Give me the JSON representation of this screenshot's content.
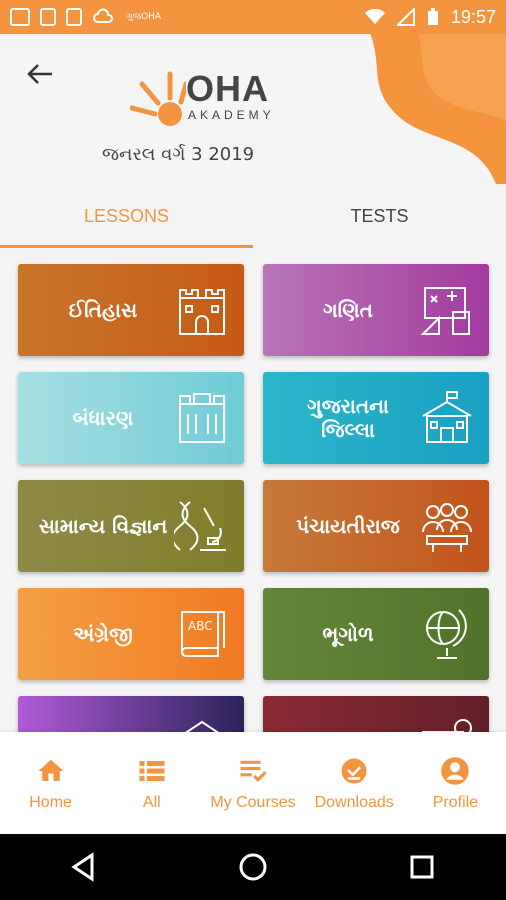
{
  "status_bar": {
    "time": "19:57",
    "small_text": "ગુજOHA"
  },
  "header": {
    "logo": {
      "main": "OHA",
      "sub": "AKADEMY"
    },
    "subtitle": "જનરલ વર્ગ 3 2019"
  },
  "tabs": [
    {
      "label": "LESSONS",
      "active": true
    },
    {
      "label": "TESTS",
      "active": false
    }
  ],
  "lessons": [
    {
      "label": "ઈતિહાસ",
      "icon": "fort-icon"
    },
    {
      "label": "ગણિત",
      "icon": "math-board-icon"
    },
    {
      "label": "બંધારણ",
      "icon": "building-icon"
    },
    {
      "label": "ગુજરાતના જિલ્લા",
      "icon": "school-icon"
    },
    {
      "label": "સામાન્ય વિજ્ઞાન",
      "icon": "microscope-dna-icon"
    },
    {
      "label": "પંચાયતીરાજ",
      "icon": "people-meeting-icon"
    },
    {
      "label": "અંગ્રેજી",
      "icon": "abc-book-icon"
    },
    {
      "label": "ભૂગોળ",
      "icon": "globe-icon"
    },
    {
      "label": "",
      "icon": "tent-icon"
    },
    {
      "label": "",
      "icon": "money-icon"
    }
  ],
  "bottom_nav": [
    {
      "label": "Home",
      "icon": "home-icon"
    },
    {
      "label": "All",
      "icon": "list-icon"
    },
    {
      "label": "My Courses",
      "icon": "my-courses-icon"
    },
    {
      "label": "Downloads",
      "icon": "download-check-icon"
    },
    {
      "label": "Profile",
      "icon": "profile-icon"
    }
  ],
  "colors": {
    "accent": "#f5943f"
  }
}
